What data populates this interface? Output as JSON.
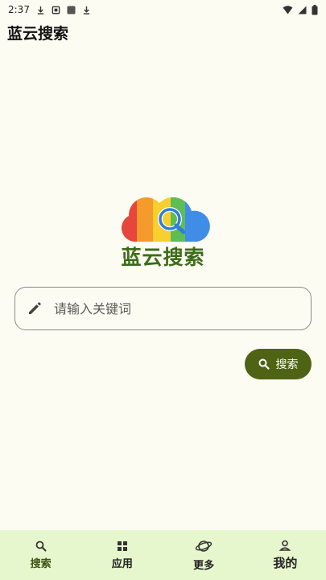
{
  "status_bar": {
    "time": "2:37"
  },
  "header": {
    "title": "蓝云搜索"
  },
  "logo": {
    "text": "蓝云搜索"
  },
  "search": {
    "placeholder": "请输入关键词",
    "value": "",
    "button_label": "搜索"
  },
  "nav": {
    "items": [
      {
        "label": "搜索",
        "icon": "search-icon",
        "active": true
      },
      {
        "label": "应用",
        "icon": "apps-icon",
        "active": false
      },
      {
        "label": "更多",
        "icon": "planet-icon",
        "active": false
      },
      {
        "label": "我的",
        "icon": "person-icon",
        "active": false
      }
    ]
  },
  "colors": {
    "background": "#fdfcf3",
    "accent": "#4e6314",
    "nav_background": "#e7f7cd",
    "logo_text": "#3c6c18"
  }
}
